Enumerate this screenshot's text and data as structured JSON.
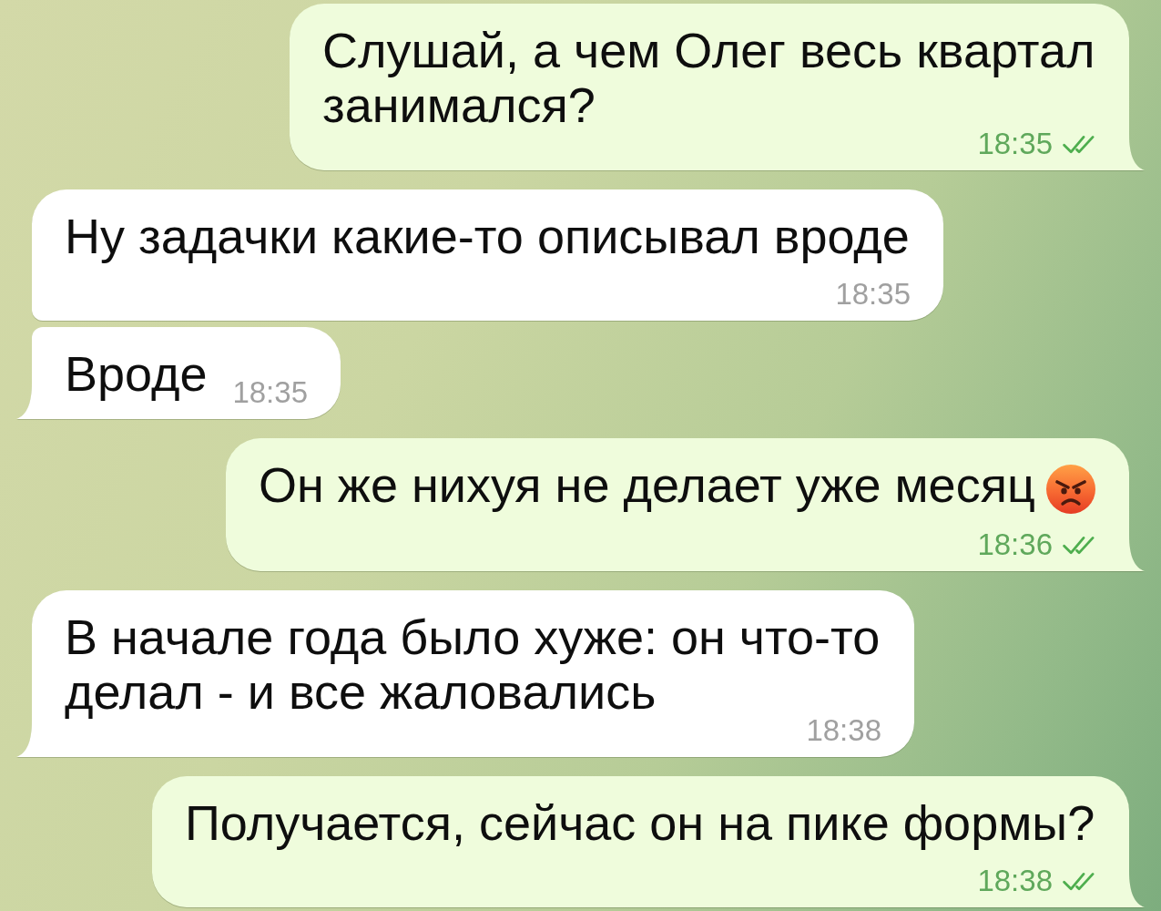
{
  "messages": [
    {
      "kind": "outgoing",
      "text": "Слушай, а чем Олег весь квартал занимался?",
      "time": "18:35",
      "read": true
    },
    {
      "kind": "incoming",
      "text": "Ну задачки какие-то описывал вроде",
      "time": "18:35"
    },
    {
      "kind": "incoming",
      "text": "Вроде",
      "time": "18:35"
    },
    {
      "kind": "outgoing",
      "text": "Он же нихуя не делает уже месяц",
      "emoji": {
        "kind": "angry"
      },
      "time": "18:36",
      "read": true
    },
    {
      "kind": "incoming",
      "text": "В начале года было хуже: он что-то делал - и все жаловались",
      "time": "18:38"
    },
    {
      "kind": "outgoing",
      "text": "Получается, сейчас он на пике формы?",
      "time": "18:38",
      "read": true
    }
  ]
}
